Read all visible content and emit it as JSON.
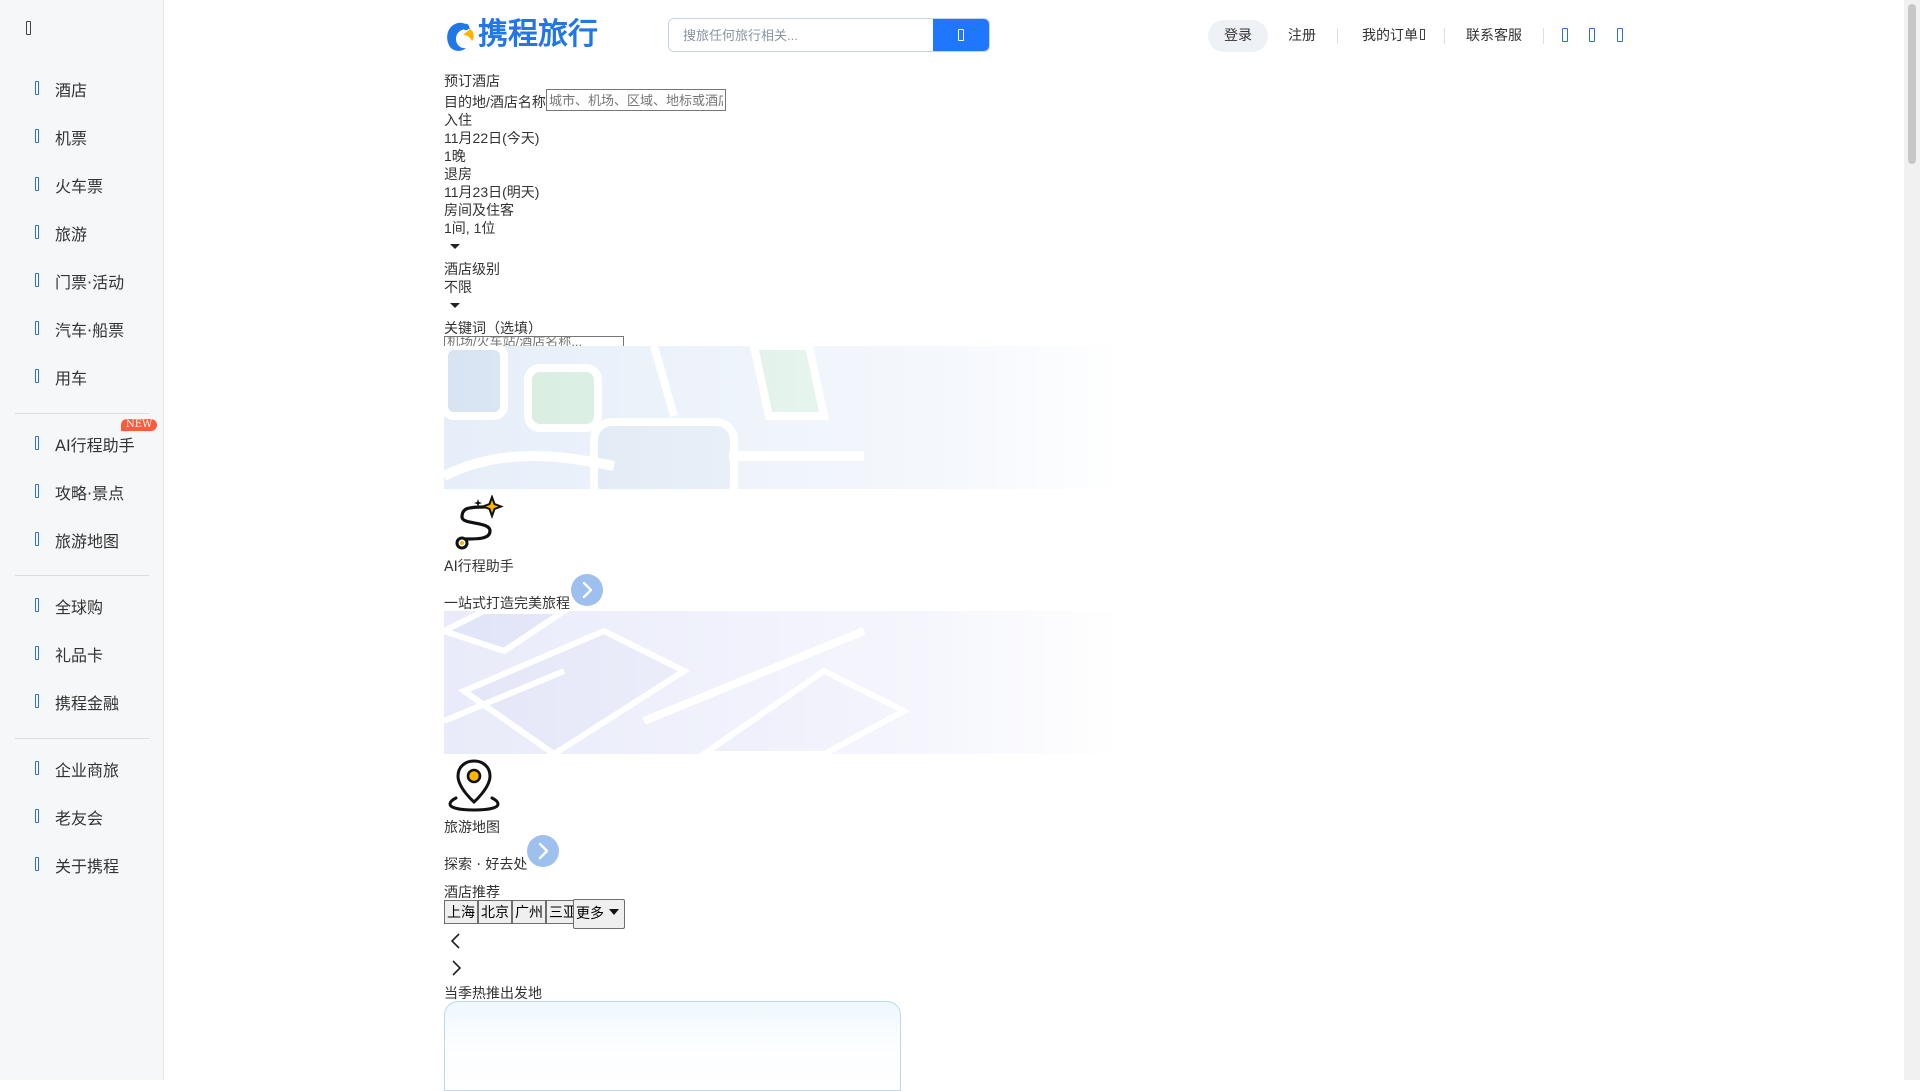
{
  "sidebar": {
    "items_a": [
      {
        "label": "酒店"
      },
      {
        "label": "机票"
      },
      {
        "label": "火车票"
      },
      {
        "label": "旅游"
      },
      {
        "label": "门票·活动"
      },
      {
        "label": "汽车·船票"
      },
      {
        "label": "用车"
      }
    ],
    "items_b": [
      {
        "label": "AI行程助手",
        "badge": "NEW"
      },
      {
        "label": "攻略·景点"
      },
      {
        "label": "旅游地图"
      }
    ],
    "items_c": [
      {
        "label": "全球购"
      },
      {
        "label": "礼品卡"
      },
      {
        "label": "携程金融"
      }
    ],
    "items_d": [
      {
        "label": "企业商旅"
      },
      {
        "label": "老友会"
      },
      {
        "label": "关于携程"
      }
    ]
  },
  "header": {
    "logo_text": "携程旅行",
    "search_placeholder": "搜旅任何旅行相关...",
    "login": "登录",
    "register": "注册",
    "my_orders": "我的订单",
    "customer_service": "联系客服",
    "icons": [
      "app-icon",
      "message-icon",
      "user-icon"
    ]
  },
  "hotel_form": {
    "title": "预订酒店",
    "dest_label": "目的地/酒店名称",
    "dest_placeholder": "城市、机场、区域、地标或酒店名称",
    "checkin_label": "入住",
    "checkin_date": "11月22日(今天)",
    "nights": "1晚",
    "checkout_label": "退房",
    "checkout_date": "11月23日(明天)",
    "rooms_label": "房间及住客",
    "rooms_value": "1间, 1位",
    "level_label": "酒店级别",
    "level_value": "不限",
    "keyword_label": "关键词（选填）",
    "keyword_placeholder": "机场/火车站/酒店名称..."
  },
  "promos": [
    {
      "title": "AI行程助手",
      "subtitle": "一站式打造完美旅程",
      "icon": "route-sparkle-icon"
    },
    {
      "title": "旅游地图",
      "subtitle": "探索 · 好去处",
      "icon": "map-pin-icon"
    }
  ],
  "recommend": {
    "title": "酒店推荐",
    "cities": [
      "上海",
      "北京",
      "广州",
      "三亚"
    ],
    "more": "更多",
    "season_title": "当季热推出发地"
  },
  "colors": {
    "brand": "#1f77ff",
    "sidebar_bg": "#f6f7f9",
    "badge": "#ff5a3c"
  }
}
